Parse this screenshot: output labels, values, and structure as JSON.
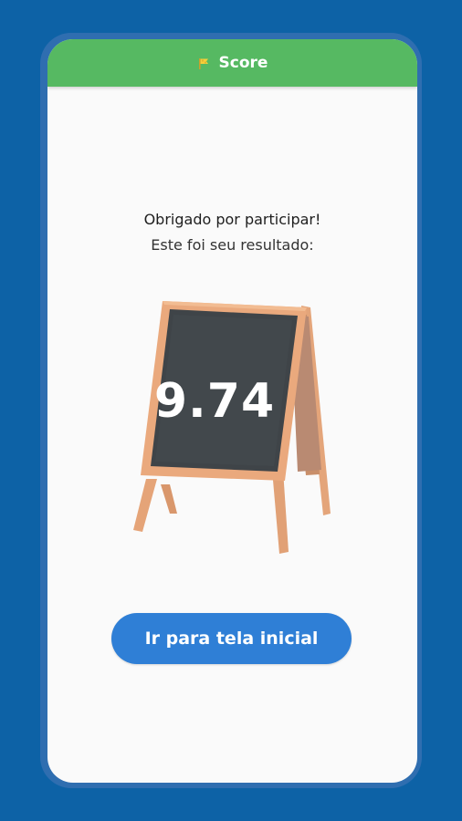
{
  "app_bar": {
    "title": "Score",
    "icon": "flag-icon"
  },
  "message": {
    "line1": "Obrigado por participar!",
    "line2": "Este foi seu resultado:"
  },
  "score": {
    "value": "9.74"
  },
  "home_button": {
    "label": "Ir para tela inicial"
  },
  "colors": {
    "background": "#0d62a6",
    "app_bar": "#56b962",
    "button": "#2f7fd6",
    "board": "#3e4347",
    "frame_wood": "#e8a47a"
  }
}
